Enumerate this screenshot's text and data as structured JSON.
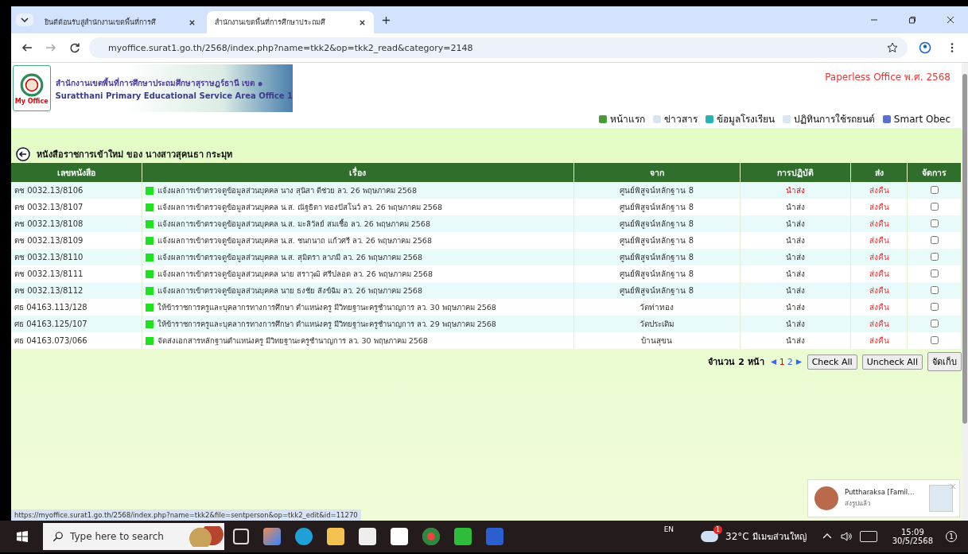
{
  "browser": {
    "tabs": [
      {
        "title": "ยินดีต้อนรับสู่สำนักงานเขตพื้นที่การศึ",
        "selected": false
      },
      {
        "title": "สำนักงานเขตพื้นที่การศึกษาประถมศึ",
        "selected": true
      }
    ],
    "address": "myoffice.surat1.go.th/2568/index.php?name=tkk2&op=tkk2_read&category=2148"
  },
  "banner": {
    "title_th": "สำนักงานเขตพื้นที่การศึกษาประถมศึกษาสุราษฎร์ธานี เขต ๑",
    "title_en": "Suratthani Primary Educational Service Area Office 1",
    "logo_text": "My Office"
  },
  "edition": "Paperless Office พ.ศ. 2568",
  "nav": [
    "หน้าแรก",
    "ข่าวสาร",
    "ข้อมูลโรงเรียน",
    "ปฏิทินการใช้รถยนต์",
    "Smart Obec"
  ],
  "heading": "หนังสือราชการเข้าใหม่ ของ นางสาวสุคนธา กระมุท",
  "table": {
    "columns": [
      "เลขหนังสือ",
      "เรื่อง",
      "จาก",
      "การปฏิบัติ",
      "ส่ง",
      "จัดการ"
    ],
    "rows": [
      {
        "number": "ตช 0032.13/8106",
        "subject": "แจ้งผลการเข้าตรวจดูข้อมูลส่วนบุคคล นาง สุนิสา ดีช่วย   ลว. 26 พฤษภาคม 2568",
        "from": "ศูนย์พิสูจน์หลักฐาน 8",
        "action": "นำส่ง",
        "action_alert": true,
        "send": "ส่งคืน",
        "checked": false
      },
      {
        "number": "ตช 0032.13/8107",
        "subject": "แจ้งผลการเข้าตรวจดูข้อมูลส่วนบุคคล น.ส. ณัฐธิตา ทองปัสโนว์   ลว. 26 พฤษภาคม 2568",
        "from": "ศูนย์พิสูจน์หลักฐาน 8",
        "action": "นำส่ง",
        "action_alert": false,
        "send": "ส่งคืน",
        "checked": false
      },
      {
        "number": "ตช 0032.13/8108",
        "subject": "แจ้งผลการเข้าตรวจดูข้อมูลส่วนบุคคล น.ส. มะลิวัลย์ สมเชื้อ   ลว. 26 พฤษภาคม 2568",
        "from": "ศูนย์พิสูจน์หลักฐาน 8",
        "action": "นำส่ง",
        "action_alert": false,
        "send": "ส่งคืน",
        "checked": false
      },
      {
        "number": "ตช 0032.13/8109",
        "subject": "แจ้งผลการเข้าตรวจดูข้อมูลส่วนบุคคล น.ส. ชนกนาถ แก้วศรี   ลว. 26 พฤษภาคม 2568",
        "from": "ศูนย์พิสูจน์หลักฐาน 8",
        "action": "นำส่ง",
        "action_alert": false,
        "send": "ส่งคืน",
        "checked": false
      },
      {
        "number": "ตช 0032.13/8110",
        "subject": "แจ้งผลการเข้าตรวจดูข้อมูลส่วนบุคคล น.ส. สุมิตรา ลาภมี   ลว. 26 พฤษภาคม 2568",
        "from": "ศูนย์พิสูจน์หลักฐาน 8",
        "action": "นำส่ง",
        "action_alert": false,
        "send": "ส่งคืน",
        "checked": false
      },
      {
        "number": "ตช 0032.13/8111",
        "subject": "แจ้งผลการเข้าตรวจดูข้อมูลส่วนบุคคล นาย สราวุฒิ ศรีปลอด   ลว. 26 พฤษภาคม 2568",
        "from": "ศูนย์พิสูจน์หลักฐาน 8",
        "action": "นำส่ง",
        "action_alert": false,
        "send": "ส่งคืน",
        "checked": false
      },
      {
        "number": "ตช 0032.13/8112",
        "subject": "แจ้งผลการเข้าตรวจดูข้อมูลส่วนบุคคล นาย ธงชัย สังข์ฉิม   ลว. 26 พฤษภาคม 2568",
        "from": "ศูนย์พิสูจน์หลักฐาน 8",
        "action": "นำส่ง",
        "action_alert": false,
        "send": "ส่งคืน",
        "checked": false
      },
      {
        "number": "ศธ 04163.113/128",
        "subject": "ให้ข้าราชการครูและบุคลากรทางการศึกษา ตำแหน่งครู มีวิทยฐานะครูชำนาญการ   ลว. 30 พฤษภาคม 2568",
        "from": "วัดท่าทอง",
        "action": "นำส่ง",
        "action_alert": false,
        "send": "ส่งคืน",
        "checked": false
      },
      {
        "number": "ศธ 04163.125/107",
        "subject": "ให้ข้าราชการครูและบุคลากรทางการศึกษา ตำแหน่งครู มีวิทยฐานะครูชำนาญการ   ลว. 29 พฤษภาคม 2568",
        "from": "วัดประเดิม",
        "action": "นำส่ง",
        "action_alert": false,
        "send": "ส่งคืน",
        "checked": false
      },
      {
        "number": "ศธ 04163.073/066",
        "subject": "จัดส่งเอกสารหลักฐานตำแหน่งครู มีวิทยฐานะครูชำนาญการ   ลว. 30 พฤษภาคม 2568",
        "from": "บ้านสุขน",
        "action": "นำส่ง",
        "action_alert": false,
        "send": "ส่งคืน",
        "checked": false
      }
    ]
  },
  "pagination": {
    "label": "จำนวน 2 หน้า",
    "pages": [
      {
        "label": "1",
        "selected": true
      },
      {
        "label": "2",
        "selected": false
      }
    ],
    "buttons": [
      "Check All",
      "Uncheck All",
      "จัดเก็บ"
    ]
  },
  "status_url": "https://myoffice.surat1.go.th/2568/index.php?name=tkk2&file=sentperson&op=tkk2_edit&id=11270",
  "notification": {
    "title": "Puttharaksa [Famil...",
    "text": "ส่งรูปแล้ว"
  },
  "taskbar": {
    "search_placeholder": "Type here to search",
    "language": "EN",
    "weather_badge": "1",
    "temperature": "32°C",
    "weather": "มีเมฆส่วนใหญ่",
    "time": "15:09",
    "date": "30/5/2568",
    "notification_count": "1"
  }
}
